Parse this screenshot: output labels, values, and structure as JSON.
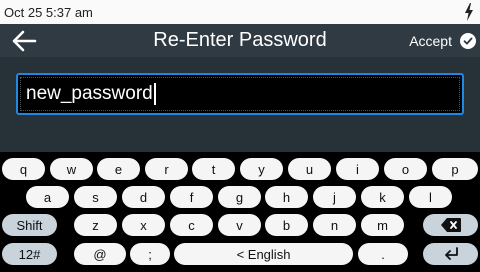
{
  "status_bar": {
    "datetime": "Oct 25 5:37 am",
    "icon": "charging-bolt-icon"
  },
  "header": {
    "title": "Re-Enter Password",
    "accept_label": "Accept",
    "back_icon": "back-arrow-icon",
    "accept_icon": "check-circle-icon"
  },
  "password_field": {
    "value": "new_password"
  },
  "keyboard": {
    "row1": [
      "q",
      "w",
      "e",
      "r",
      "t",
      "y",
      "u",
      "i",
      "o",
      "p"
    ],
    "row2": [
      "a",
      "s",
      "d",
      "f",
      "g",
      "h",
      "j",
      "k",
      "l"
    ],
    "shift_label": "Shift",
    "row3": [
      "z",
      "x",
      "c",
      "v",
      "b",
      "n",
      "m"
    ],
    "backspace_icon": "backspace-icon",
    "mode_label": "12#",
    "at_label": "@",
    "semicolon_label": ";",
    "space_label": "< English",
    "period_label": ".",
    "enter_icon": "enter-icon"
  },
  "colors": {
    "accent": "#1e88e5",
    "header_bg": "#2f3a43",
    "content_bg": "#263138",
    "key_bg": "#f5f5f5",
    "fn_key_bg": "#c9d3db"
  }
}
